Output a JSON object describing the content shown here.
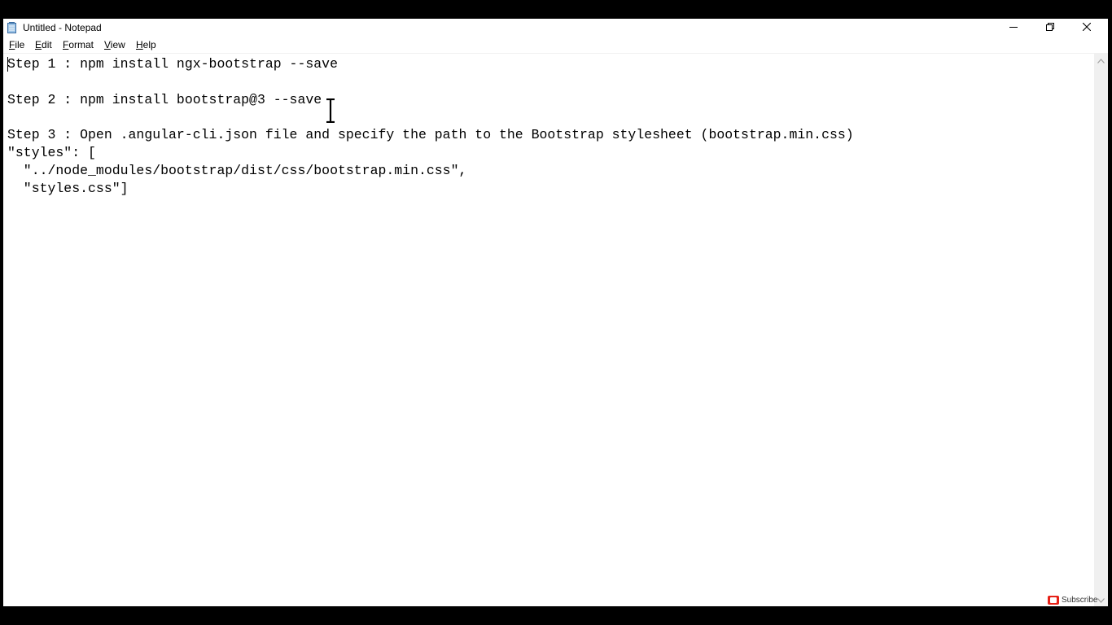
{
  "window": {
    "title": "Untitled - Notepad"
  },
  "menu": {
    "file": {
      "mnemonic": "F",
      "rest": "ile"
    },
    "edit": {
      "mnemonic": "E",
      "rest": "dit"
    },
    "format": {
      "mnemonic": "F",
      "rest": "ormat"
    },
    "view": {
      "mnemonic": "V",
      "rest": "iew"
    },
    "help": {
      "mnemonic": "H",
      "rest": "elp"
    }
  },
  "editor": {
    "content": "Step 1 : npm install ngx-bootstrap --save\n\nStep 2 : npm install bootstrap@3 --save\n\nStep 3 : Open .angular-cli.json file and specify the path to the Bootstrap stylesheet (bootstrap.min.css)\n\"styles\": [\n  \"../node_modules/bootstrap/dist/css/bootstrap.min.css\",\n  \"styles.css\"]"
  },
  "overlay": {
    "subscribe_label": "Subscribe"
  },
  "icons": {
    "app": "notepad-icon",
    "minimize": "minimize-icon",
    "maximize": "restore-icon",
    "close": "close-icon",
    "text_cursor": "text-cursor-icon",
    "scroll_up": "chevron-up-icon",
    "scroll_down": "chevron-down-icon",
    "subscribe": "youtube-subscribe-icon"
  },
  "colors": {
    "background": "#000000",
    "window": "#ffffff",
    "scrollbar": "#f0f0f0",
    "subscribe_red": "#e62117"
  }
}
